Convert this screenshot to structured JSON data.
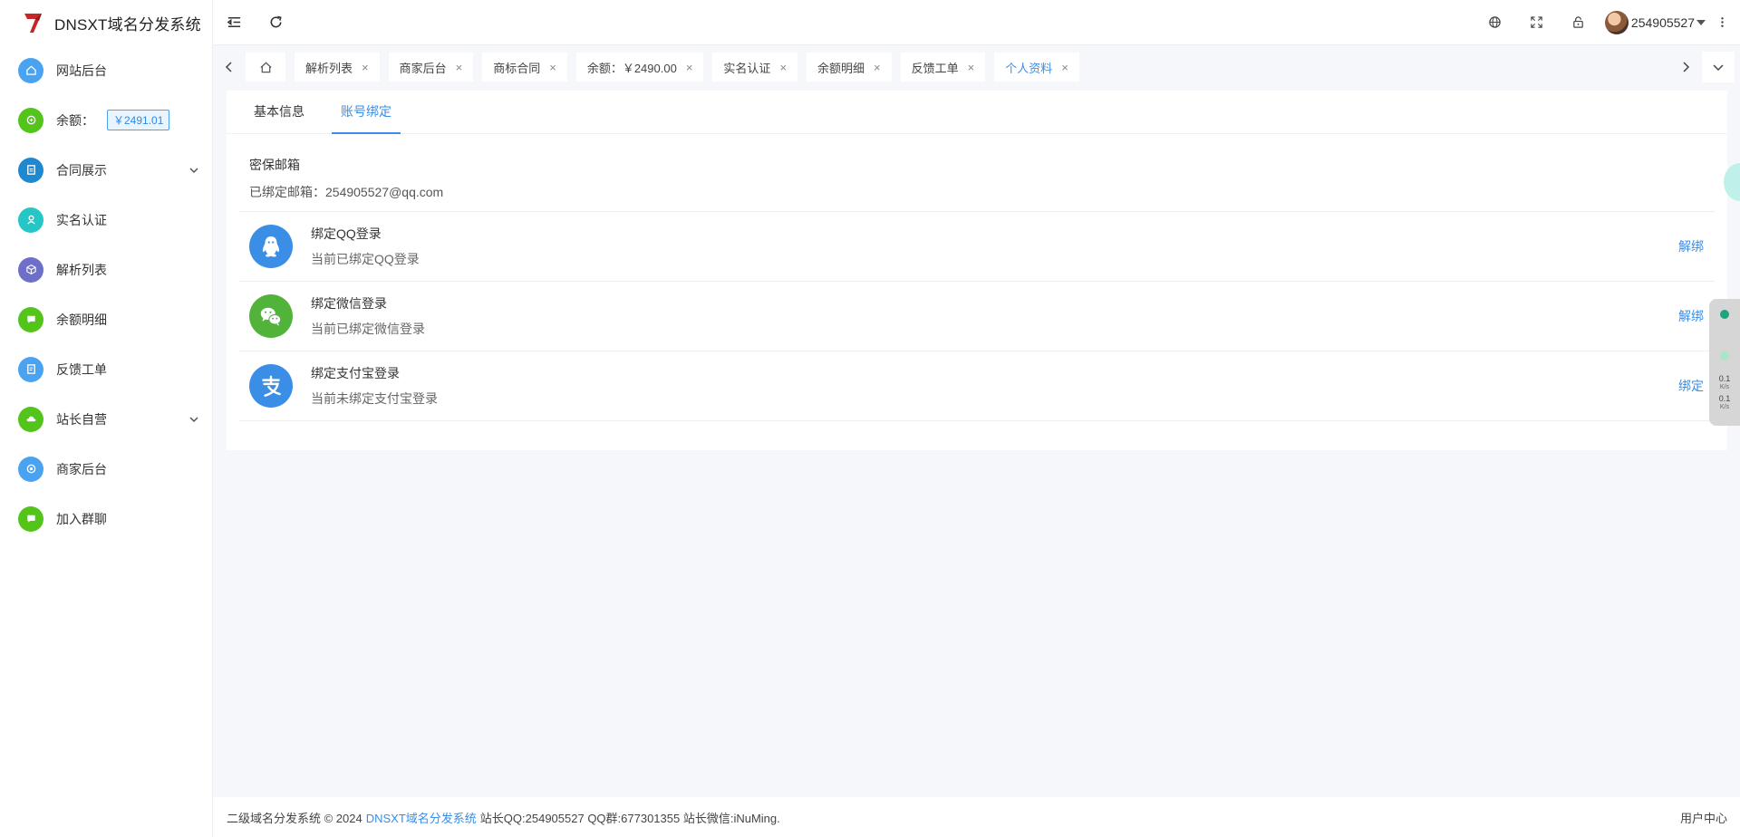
{
  "app": {
    "title": "DNSXT域名分发系统"
  },
  "sidebar": {
    "items": [
      {
        "label": "网站后台",
        "icon": "home-icon",
        "color": "#4aa3f0"
      },
      {
        "label": "余额：",
        "icon": "wallet-icon",
        "color": "#52c41a",
        "badge": "￥2491.01"
      },
      {
        "label": "合同展示",
        "icon": "document-icon",
        "color": "#1e88d0",
        "expandable": true
      },
      {
        "label": "实名认证",
        "icon": "user-verify-icon",
        "color": "#26c6c6"
      },
      {
        "label": "解析列表",
        "icon": "cube-icon",
        "color": "#6d6fc9"
      },
      {
        "label": "余额明细",
        "icon": "chat-icon",
        "color": "#52c41a"
      },
      {
        "label": "反馈工单",
        "icon": "ticket-icon",
        "color": "#4aa3f0"
      },
      {
        "label": "站长自营",
        "icon": "cloud-icon",
        "color": "#52c41a",
        "expandable": true
      },
      {
        "label": "商家后台",
        "icon": "settings-icon",
        "color": "#4aa3f0"
      },
      {
        "label": "加入群聊",
        "icon": "message-icon",
        "color": "#52c41a"
      }
    ]
  },
  "header": {
    "user_name": "254905527"
  },
  "tabs": [
    {
      "label": "解析列表"
    },
    {
      "label": "商家后台"
    },
    {
      "label": "商标合同"
    },
    {
      "label": "余额：￥2490.00"
    },
    {
      "label": "实名认证"
    },
    {
      "label": "余额明细"
    },
    {
      "label": "反馈工单"
    },
    {
      "label": "个人资料",
      "active": true
    }
  ],
  "close_glyph": "×",
  "profile": {
    "subtabs": [
      {
        "label": "基本信息"
      },
      {
        "label": "账号绑定",
        "active": true
      }
    ],
    "email": {
      "title": "密保邮箱",
      "line": "已绑定邮箱：254905527@qq.com"
    },
    "bindings": [
      {
        "title": "绑定QQ登录",
        "desc": "当前已绑定QQ登录",
        "action": "解绑",
        "icon": "qq-icon",
        "color": "#3a8ee6"
      },
      {
        "title": "绑定微信登录",
        "desc": "当前已绑定微信登录",
        "action": "解绑",
        "icon": "wechat-icon",
        "color": "#52b33a"
      },
      {
        "title": "绑定支付宝登录",
        "desc": "当前未绑定支付宝登录",
        "action": "绑定",
        "icon": "alipay-icon",
        "color": "#3a8ee6"
      }
    ]
  },
  "net_widget": {
    "up": "0.1",
    "down": "0.1",
    "unit": "K/s"
  },
  "footer": {
    "prefix": "二级域名分发系统 © 2024",
    "link": "DNSXT域名分发系统",
    "suffix": "站长QQ:254905527 QQ群:677301355 站长微信:iNuMing.",
    "right": "用户中心"
  }
}
